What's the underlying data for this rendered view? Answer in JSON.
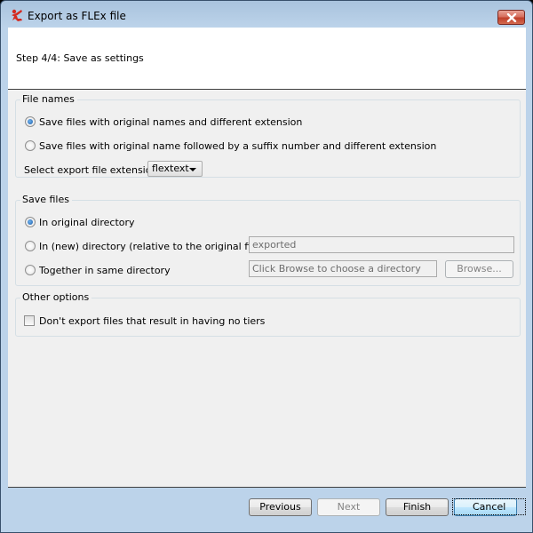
{
  "window": {
    "title": "Export as FLEx file",
    "icon": "flex-app-icon",
    "close_icon": "close-icon"
  },
  "header": {
    "step": "Step 4/4: Save as settings"
  },
  "file_names": {
    "title": "File names",
    "options": [
      {
        "label": "Save files with original names and different extension",
        "selected": true
      },
      {
        "label": "Save files with original name followed by a suffix number and different extension",
        "selected": false
      }
    ],
    "extension_label": "Select export file extension",
    "extension_value": "flextext"
  },
  "save_files": {
    "title": "Save files",
    "options": [
      {
        "label": "In original directory",
        "selected": true
      },
      {
        "label": "In (new) directory (relative to the original file):",
        "selected": false
      },
      {
        "label": "Together in same directory",
        "selected": false
      }
    ],
    "new_directory_value": "exported",
    "same_directory_placeholder": "Click Browse to choose a directory",
    "browse_label": "Browse..."
  },
  "other_options": {
    "title": "Other options",
    "no_tiers_label": "Don't export files that result in having no tiers",
    "no_tiers_checked": false
  },
  "footer": {
    "previous": "Previous",
    "next": "Next",
    "finish": "Finish",
    "cancel": "Cancel"
  }
}
